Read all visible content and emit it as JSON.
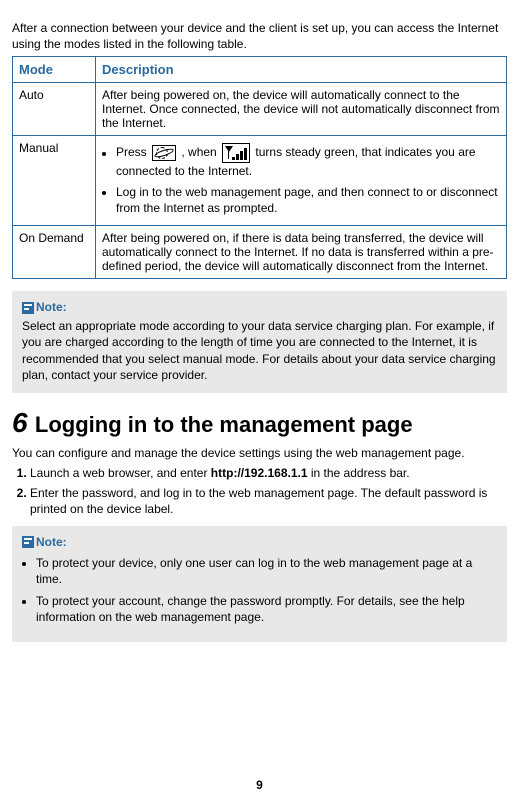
{
  "intro": "After a connection between your device and the client is set up, you can access the Internet using the modes listed in the following table.",
  "table": {
    "headers": {
      "mode": "Mode",
      "desc": "Description"
    },
    "rows": {
      "auto": {
        "mode": "Auto",
        "desc": "After being powered on, the device will automatically connect to the Internet. Once connected, the device will not automatically disconnect from the Internet."
      },
      "manual": {
        "mode": "Manual",
        "b1_a": "Press ",
        "b1_b": ", when ",
        "b1_c": " turns steady green, that indicates you are connected to the Internet.",
        "b2": "Log in to the web management page, and then connect to or disconnect from the Internet as prompted."
      },
      "ondemand": {
        "mode": "On Demand",
        "desc": "After being powered on, if there is data being transferred, the device will automatically connect to the Internet. If no data is transferred within a pre-defined period, the device will automatically disconnect from the Internet."
      }
    }
  },
  "note1": {
    "label": "Note:",
    "body": "Select an appropriate mode according to your data service charging plan. For example, if you are charged according to the length of time you are connected to the Internet, it is recommended that you select manual mode. For details about your data service charging plan, contact your service provider."
  },
  "section6": {
    "num": "6",
    "title": "Logging in to the management page",
    "intro": "You can configure and manage the device settings using the web management page.",
    "step1_a": "Launch a web browser, and enter ",
    "step1_bold": "http://192.168.1.1",
    "step1_b": " in the address bar.",
    "step2": "Enter the password, and log in to the web management page. The default password is printed on the device label."
  },
  "note2": {
    "label": "Note:",
    "b1": "To protect your device, only one user can log in to the web management page at a time.",
    "b2": "To protect your account, change the password promptly. For details, see the help information on the web management page."
  },
  "pageNumber": "9"
}
